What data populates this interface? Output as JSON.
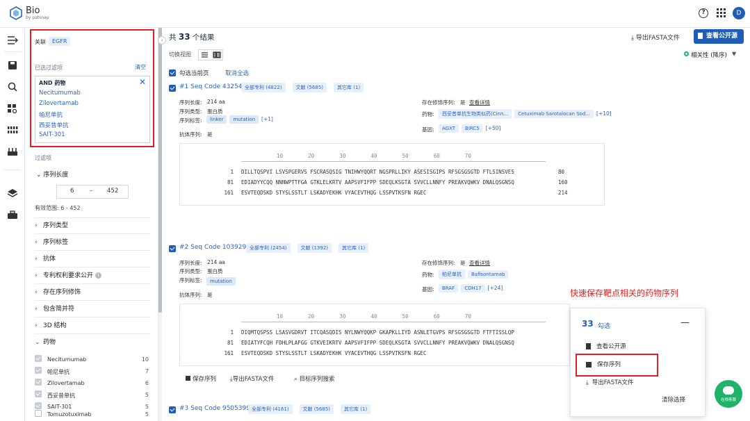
{
  "app": {
    "title": "Bio",
    "subtitle": "by patsnap",
    "avatar_letter": "D",
    "help_glyph": "?"
  },
  "sidebar": {
    "related_label": "关联",
    "related_tag": "EGFR",
    "selected_filters_label": "已选过滤项",
    "clear_label": "清空",
    "and_label": "AND 药物",
    "filter_values": [
      "Necitumumab",
      "Zilovertamab",
      "帕尼单抗",
      "西妥昔单抗",
      "SAIT-301"
    ],
    "filters_label": "过滤项",
    "seq_length": {
      "label": "序列长度",
      "min": "6",
      "max": "452",
      "dash": "–",
      "range_text": "有效范围:  6 - 452"
    },
    "facets": [
      "序列类型",
      "序列标签",
      "抗体",
      "专利权利要求公开",
      "存在序列修饰",
      "包含简并符",
      "3D 结构"
    ],
    "drug_facet_label": "药物",
    "drugs": [
      {
        "name": "Necitumumab",
        "count": "10",
        "state": "dis"
      },
      {
        "name": "帕尼单抗",
        "count": "7",
        "state": "dis"
      },
      {
        "name": "Zilovertamab",
        "count": "6",
        "state": "dis"
      },
      {
        "name": "西妥昔单抗",
        "count": "5",
        "state": "dis"
      },
      {
        "name": "SAIT-301",
        "count": "5",
        "state": "dis"
      },
      {
        "name": "Tomuzotuximab",
        "count": "5",
        "state": "off"
      }
    ]
  },
  "main": {
    "result_prefix": "共",
    "result_count": "33",
    "result_suffix": "个结果",
    "export_fasta": "导出FASTA文件",
    "view_public": "查看公开源",
    "switch_view": "切换视图",
    "sort_label": "相关性 (降序)",
    "select_page": "勾选当前页",
    "cancel_all": "取消全选",
    "records": [
      {
        "title": "#1 Seq Code 43254",
        "tags": [
          "全部专利 (4822)",
          "文献 (5685)",
          "其它库 (1)"
        ],
        "seq_len_label": "序列长度:",
        "seq_len": "214 aa",
        "seq_type_label": "序列类型:",
        "seq_type": "蛋白质",
        "seq_tag_label": "序列标签:",
        "seq_tags": [
          "linker",
          "mutation"
        ],
        "seq_tag_more": "[+1]",
        "antibody_label": "抗体序列:",
        "antibody": "是",
        "mod_label": "存在修饰序列:",
        "mod": "是",
        "mod_link": "查看详情",
        "drug_label": "药物:",
        "drug_tags": [
          "西妥昔单抗生物类似药(Cinn...",
          "Cetuximab Sarotalocan Sod..."
        ],
        "drug_more": "[+10]",
        "gene_label": "基因:",
        "gene_tags": [
          "AGXT",
          "BIRC5"
        ],
        "gene_more": "[+50]",
        "ruler": "10        20        30        40        50        60        70",
        "lines": [
          {
            "pos": "1",
            "seq": "DILLTQSPVI LSVSPGERVS FSCRASQSIG TNIHWYQQRT NGSPRLLIKY ASESISGIPS RFSGSGSGTD FTLSINSVES",
            "end": "80"
          },
          {
            "pos": "81",
            "seq": "EDIADYYCQQ NNNWPTTFGA GTKLELKRTV AAPSVFIFPP SDEQLKSGTA SVVCLLNNFY PREAKVQWKV DNALQSGNSQ",
            "end": "160"
          },
          {
            "pos": "161",
            "seq": "ESVTEQDSKD STYSLSSTLT LSKADYEKHK VYACEVTHQG LSSPVTKSFN RGEC",
            "end": "214"
          }
        ]
      },
      {
        "title": "#2 Seq Code 103929",
        "tags": [
          "全部专利 (2454)",
          "文献 (1392)",
          "其它库 (1)"
        ],
        "seq_len_label": "序列长度:",
        "seq_len": "214 aa",
        "seq_type_label": "序列类型:",
        "seq_type": "蛋白质",
        "seq_tag_label": "序列标签:",
        "seq_tags": [
          "mutation"
        ],
        "antibody_label": "抗体序列:",
        "antibody": "是",
        "mod_label": "存在修饰序列:",
        "mod": "是",
        "mod_link": "查看详情",
        "drug_label": "药物:",
        "drug_tags": [
          "帕尼单抗",
          "Bafisontamab"
        ],
        "gene_label": "基因:",
        "gene_tags": [
          "BRAF",
          "CDH17"
        ],
        "gene_more": "[+24]",
        "ruler": "10        20        30        40        50        60        70",
        "lines": [
          {
            "pos": "1",
            "seq": "DIQMTQSPSS LSASVGDRVT ITCQASQDIS NYLNWYQQKP GKAPKLLIYD ASNLETGVPS RFSGSGSGTD FTFTISSLQP"
          },
          {
            "pos": "81",
            "seq": "EDIATYFCQH FDHLPLAFGG GTKVEIKRTV AAPSVFIFPP SDEQLKSGTA SVVCLLNNFY PREAKVQWKV DNALQSGNSQ"
          },
          {
            "pos": "161",
            "seq": "ESVTEQDSKD STYSLSSTLT LSKADYEKHK VYACEVTHQG LSSPVTKSFN RGEC"
          }
        ],
        "actions": [
          "保存序列",
          "导出FASTA文件",
          "目标序列搜索"
        ]
      },
      {
        "title": "#3 Seq Code 9505399",
        "tags": [
          "全部专利 (4161)",
          "文献 (5685)",
          "其它库 (1)"
        ]
      }
    ]
  },
  "float_panel": {
    "count": "33",
    "count_suffix": "勾选",
    "minimize": "—",
    "view_public": "查看公开源",
    "save_seq": "保存序列",
    "export_fasta": "导出FASTA文件",
    "clear": "清除选择"
  },
  "annotation": "快速保存靶点相关的药物序列",
  "chat_label": "在线客服",
  "colors": {
    "primary": "#1f5eb8",
    "link": "#2a64c5",
    "highlight": "#e02020",
    "chat": "#1fb36a"
  }
}
